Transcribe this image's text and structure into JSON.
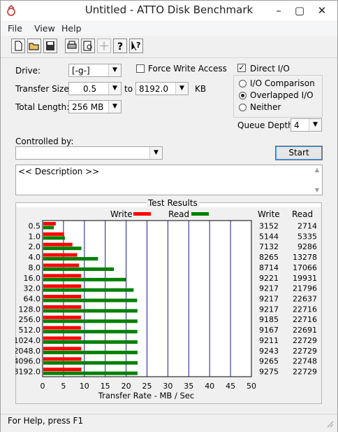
{
  "window": {
    "title": "Untitled - ATTO Disk Benchmark",
    "controls": [
      "–",
      "▢",
      "✕"
    ]
  },
  "menu": [
    "File",
    "View",
    "Help"
  ],
  "toolbar": {
    "icons": [
      "new-file-icon",
      "open-folder-icon",
      "save-disk-icon",
      "print-icon",
      "print-preview-icon",
      "move-icon",
      "help-icon",
      "context-help-icon"
    ]
  },
  "settings": {
    "drive_label": "Drive:",
    "drive_value": "[-g-]",
    "force_write_label": "Force Write Access",
    "force_write_checked": false,
    "direct_io_label": "Direct I/O",
    "direct_io_checked": true,
    "transfer_size_label": "Transfer Size:",
    "transfer_from": "0.5",
    "to_label": "to",
    "transfer_to": "8192.0",
    "kb_label": "KB",
    "total_length_label": "Total Length:",
    "total_length_value": "256 MB",
    "io_options": [
      "I/O Comparison",
      "Overlapped I/O",
      "Neither"
    ],
    "io_selected": "Overlapped I/O",
    "queue_depth_label": "Queue Depth:",
    "queue_depth_value": "4",
    "controlled_by_label": "Controlled by:",
    "controlled_by_value": "",
    "start_label": "Start",
    "description": "<< Description >>"
  },
  "results": {
    "group_title": "Test Results",
    "legend_write": "Write",
    "legend_read": "Read",
    "col_write": "Write",
    "col_read": "Read",
    "write_color": "#ff0000",
    "read_color": "#008000"
  },
  "chart_data": {
    "type": "bar",
    "orientation": "horizontal",
    "categories": [
      "0.5",
      "1.0",
      "2.0",
      "4.0",
      "8.0",
      "16.0",
      "32.0",
      "64.0",
      "128.0",
      "256.0",
      "512.0",
      "1024.0",
      "2048.0",
      "4096.0",
      "8192.0"
    ],
    "series": [
      {
        "name": "Write",
        "values": [
          3152,
          5144,
          7132,
          8265,
          8714,
          9221,
          9217,
          9217,
          9217,
          9185,
          9167,
          9211,
          9243,
          9265,
          9275
        ]
      },
      {
        "name": "Read",
        "values": [
          2714,
          5335,
          9286,
          13278,
          17066,
          19931,
          21796,
          22637,
          22716,
          22716,
          22691,
          22729,
          22729,
          22748,
          22729
        ]
      }
    ],
    "xlabel": "Transfer Rate - MB / Sec",
    "xticks": [
      "0",
      "5",
      "10",
      "15",
      "20",
      "25",
      "30",
      "35",
      "40",
      "45",
      "50"
    ],
    "xlim": [
      0,
      50
    ],
    "grid": true
  },
  "status": {
    "text": "For Help, press F1"
  }
}
